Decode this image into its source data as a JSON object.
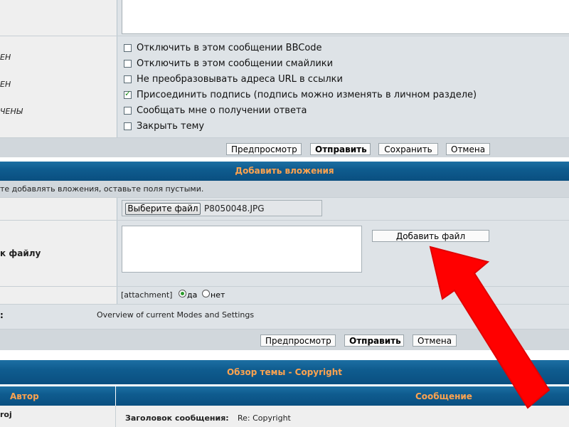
{
  "options_section": {
    "left_labels": [
      "ЕН",
      "ЕН",
      "ЧЕНЫ"
    ],
    "options": [
      {
        "label": "Отключить в этом сообщении BBCode",
        "checked": false
      },
      {
        "label": "Отключить в этом сообщении смайлики",
        "checked": false
      },
      {
        "label": "Не преобразовывать адреса URL в ссылки",
        "checked": false
      },
      {
        "label": "Присоединить подпись (подпись можно изменять в личном разделе)",
        "checked": true
      },
      {
        "label": "Сообщать мне о получении ответа",
        "checked": false
      },
      {
        "label": "Закрыть тему",
        "checked": false
      }
    ]
  },
  "buttons_top": {
    "preview": "Предпросмотр",
    "submit": "Отправить",
    "save": "Сохранить",
    "cancel": "Отмена"
  },
  "attachments": {
    "header": "Добавить вложения",
    "hint": "те добавлять вложения, оставьте поля пустыми.",
    "file_button": "Выберите файл",
    "file_name": "P8050048.JPG",
    "comment_label": "к файлу",
    "add_file_button": "Добавить файл",
    "inline_label": "[attachment]",
    "inline_yes": "да",
    "inline_no": "нет",
    "modes_left": ":",
    "modes_text": "Overview of current Modes and Settings"
  },
  "buttons_bottom": {
    "preview": "Предпросмотр",
    "submit": "Отправить",
    "cancel": "Отмена"
  },
  "topic_review": {
    "header": "Обзор темы - Copyright",
    "col_author": "Автор",
    "col_message": "Сообщение",
    "author": "roj",
    "subject_label": "Заголовок сообщения:",
    "subject_value": "Re: Copyright"
  },
  "colors": {
    "header_text": "#ffa34f",
    "arrow": "#ff0000",
    "row_bg": "#dee3e7"
  }
}
